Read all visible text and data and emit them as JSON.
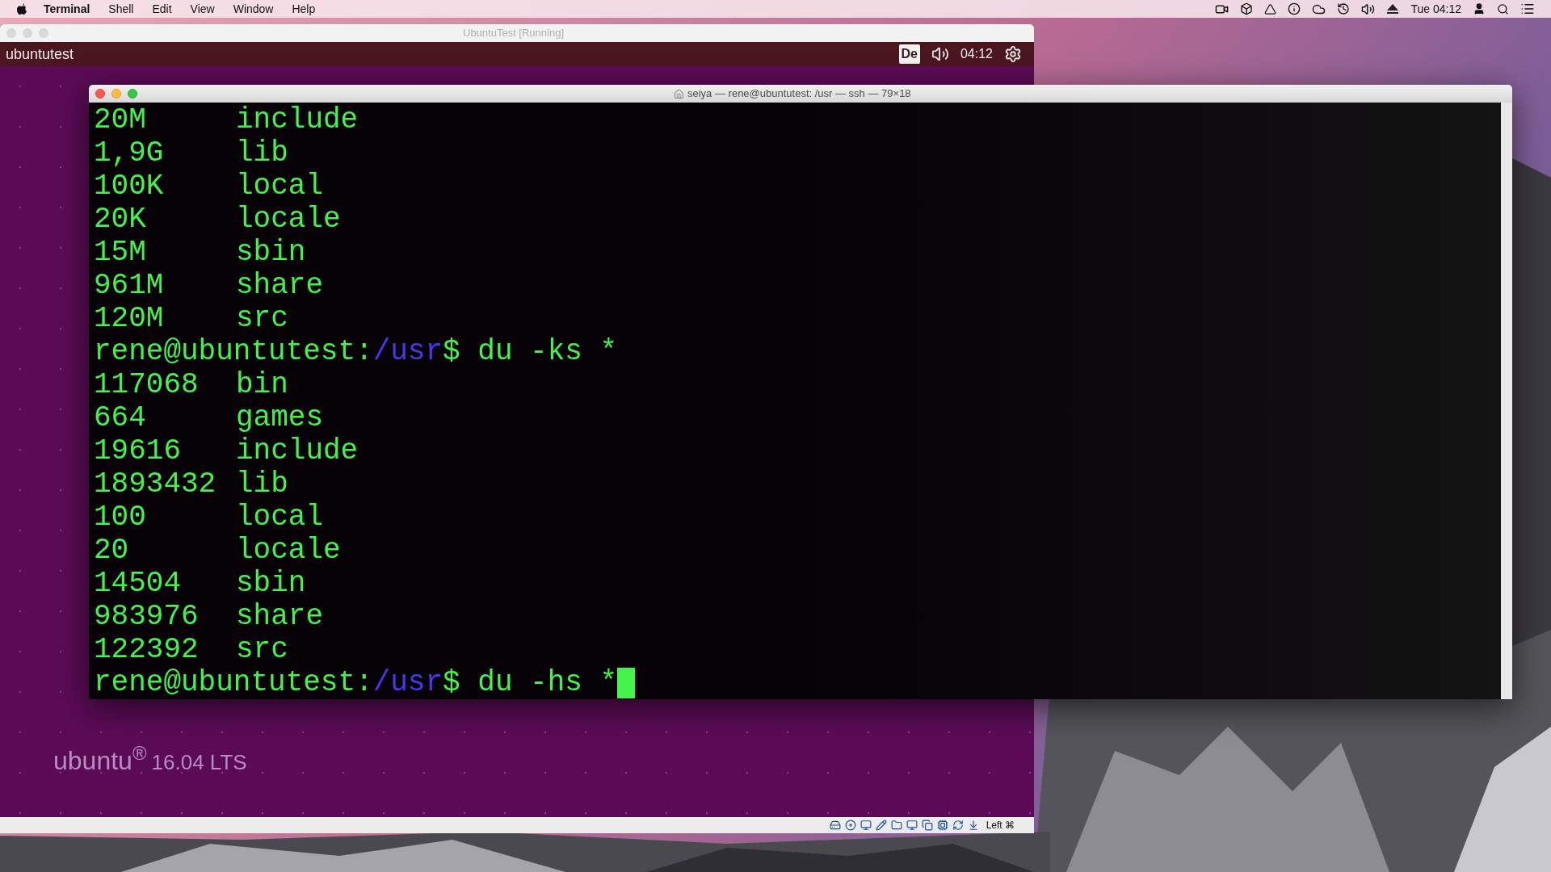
{
  "menu_bar": {
    "app": "Terminal",
    "items": [
      "Shell",
      "Edit",
      "View",
      "Window",
      "Help"
    ],
    "clock": "Tue 04:12"
  },
  "vm_window": {
    "title": "UbuntuTest [Running]",
    "hostname": "ubuntutest",
    "keyboard": "De",
    "clock": "04:12",
    "branding": {
      "name": "ubuntu$^{®}$",
      "version": "16.04 LTS"
    },
    "host_key": "Left ⌘"
  },
  "terminal": {
    "title": "seiya — rene@ubuntutest: /usr — ssh — 79×18",
    "lines": [
      {
        "kind": "output",
        "size": "20M",
        "name": "include"
      },
      {
        "kind": "output",
        "size": "1,9G",
        "name": "lib"
      },
      {
        "kind": "output",
        "size": "100K",
        "name": "local"
      },
      {
        "kind": "output",
        "size": "20K",
        "name": "locale"
      },
      {
        "kind": "output",
        "size": "15M",
        "name": "sbin"
      },
      {
        "kind": "output",
        "size": "961M",
        "name": "share"
      },
      {
        "kind": "output",
        "size": "120M",
        "name": "src"
      },
      {
        "kind": "prompt",
        "user_host": "rene@ubuntutest:",
        "path": "/usr",
        "command": "$ du -ks *",
        "cursor": false
      },
      {
        "kind": "output",
        "size": "117068",
        "name": "bin"
      },
      {
        "kind": "output",
        "size": "664",
        "name": "games"
      },
      {
        "kind": "output",
        "size": "19616",
        "name": "include"
      },
      {
        "kind": "output",
        "size": "1893432",
        "name": "lib"
      },
      {
        "kind": "output",
        "size": "100",
        "name": "local"
      },
      {
        "kind": "output",
        "size": "20",
        "name": "locale"
      },
      {
        "kind": "output",
        "size": "14504",
        "name": "sbin"
      },
      {
        "kind": "output",
        "size": "983976",
        "name": "share"
      },
      {
        "kind": "output",
        "size": "122392",
        "name": "src"
      },
      {
        "kind": "prompt",
        "user_host": "rene@ubuntutest:",
        "path": "/usr",
        "command": "$ du -hs *",
        "cursor": true
      }
    ]
  }
}
